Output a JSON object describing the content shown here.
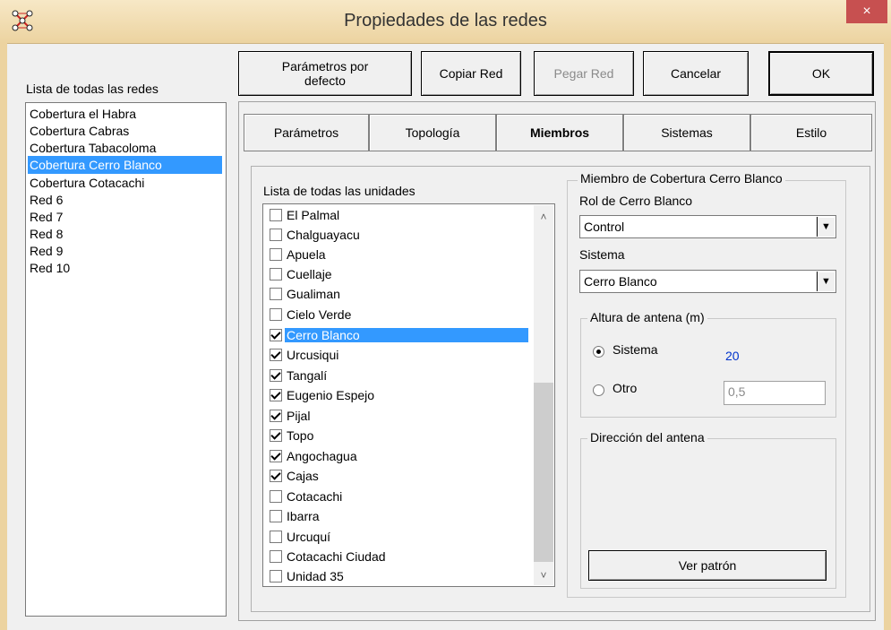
{
  "window": {
    "title": "Propiedades de las redes",
    "close_glyph": "×",
    "icon": "network-app-icon"
  },
  "toolbar": {
    "defaults_label": "Parámetros por defecto",
    "copy_label": "Copiar Red",
    "paste_label": "Pegar Red",
    "cancel_label": "Cancelar",
    "ok_label": "OK"
  },
  "networks": {
    "header": "Lista de todas las redes",
    "items": [
      {
        "label": "Cobertura el Habra"
      },
      {
        "label": "Cobertura Cabras"
      },
      {
        "label": "Cobertura Tabacoloma"
      },
      {
        "label": "Cobertura Cerro Blanco",
        "selected": true
      },
      {
        "label": "Cobertura Cotacachi"
      },
      {
        "label": "Red  6"
      },
      {
        "label": "Red  7"
      },
      {
        "label": "Red  8"
      },
      {
        "label": "Red  9"
      },
      {
        "label": "Red 10"
      }
    ]
  },
  "tabs": [
    {
      "label": "Parámetros"
    },
    {
      "label": "Topología"
    },
    {
      "label": "Miembros",
      "active": true
    },
    {
      "label": "Sistemas"
    },
    {
      "label": "Estilo"
    }
  ],
  "units": {
    "header": "Lista de todas las unidades",
    "items": [
      {
        "label": "El Palmal",
        "checked": false
      },
      {
        "label": "Chalguayacu",
        "checked": false
      },
      {
        "label": "Apuela",
        "checked": false
      },
      {
        "label": "Cuellaje",
        "checked": false
      },
      {
        "label": "Gualiman",
        "checked": false
      },
      {
        "label": "Cielo Verde",
        "checked": false
      },
      {
        "label": "Cerro Blanco",
        "checked": true,
        "selected": true
      },
      {
        "label": "Urcusiqui",
        "checked": true
      },
      {
        "label": "Tangalí",
        "checked": true
      },
      {
        "label": "Eugenio Espejo",
        "checked": true
      },
      {
        "label": "Pijal",
        "checked": true
      },
      {
        "label": "Topo",
        "checked": true
      },
      {
        "label": "Angochagua",
        "checked": true
      },
      {
        "label": "Cajas",
        "checked": true
      },
      {
        "label": "Cotacachi",
        "checked": false
      },
      {
        "label": "Ibarra",
        "checked": false
      },
      {
        "label": "Urcuquí",
        "checked": false
      },
      {
        "label": "Cotacachi Ciudad",
        "checked": false
      },
      {
        "label": "Unidad  35",
        "checked": false
      }
    ]
  },
  "member": {
    "group_title": "Miembro de Cobertura Cerro Blanco",
    "role_label": "Rol de Cerro Blanco",
    "role_value": "Control",
    "system_label": "Sistema",
    "system_value": "Cerro Blanco",
    "antenna_height": {
      "title": "Altura de antena (m)",
      "option_system": "Sistema",
      "system_value": "20",
      "option_other": "Otro",
      "other_value": "0,5",
      "selected": "Sistema"
    },
    "direction": {
      "title": "Dirección del antena",
      "pattern_button": "Ver patrón"
    }
  },
  "colors": {
    "selection": "#3399ff",
    "close_button": "#c75050",
    "value_blue": "#0033cc",
    "titlebar": "#ecd3a0"
  }
}
